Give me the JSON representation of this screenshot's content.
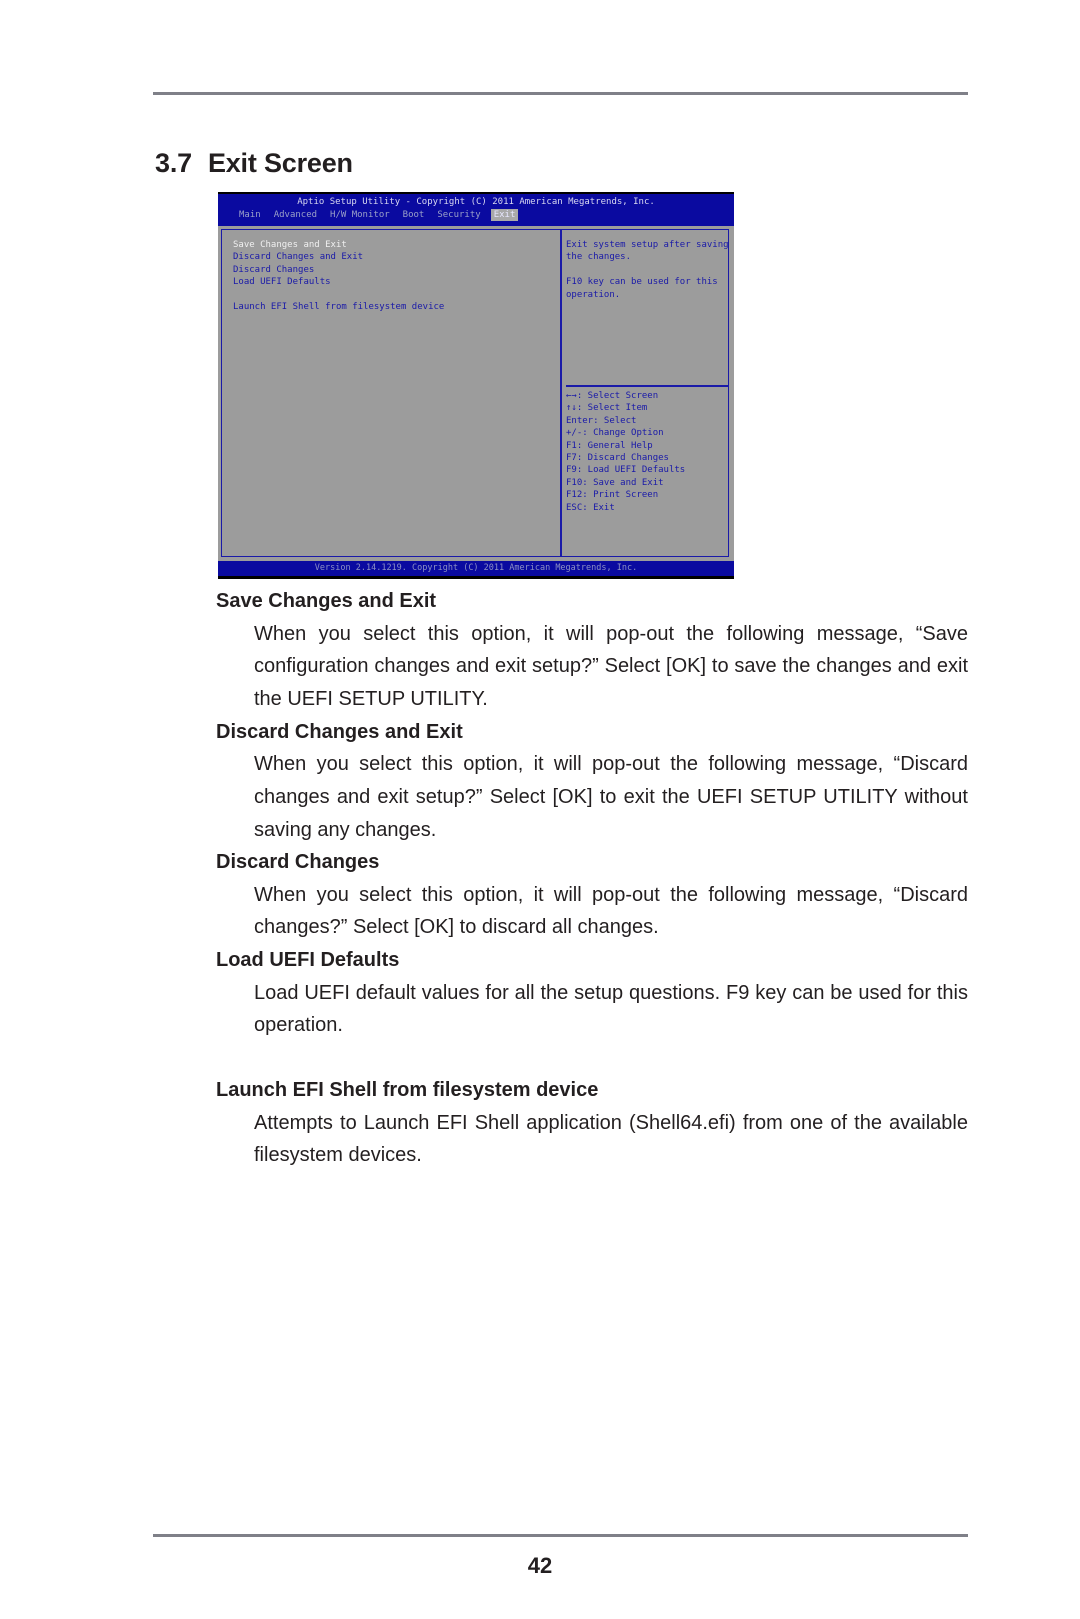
{
  "section": {
    "number": "3.7",
    "title": "Exit Screen"
  },
  "bios": {
    "header_title": "Aptio Setup Utility - Copyright (C) 2011 American Megatrends, Inc.",
    "tabs": [
      {
        "label": "Main",
        "active": false
      },
      {
        "label": "Advanced",
        "active": false
      },
      {
        "label": "H/W Monitor",
        "active": false
      },
      {
        "label": "Boot",
        "active": false
      },
      {
        "label": "Security",
        "active": false
      },
      {
        "label": "Exit",
        "active": true
      }
    ],
    "menu_items": [
      {
        "label": "Save Changes and Exit",
        "selected": true
      },
      {
        "label": "Discard Changes and Exit",
        "selected": false
      },
      {
        "label": "Discard Changes",
        "selected": false
      },
      {
        "label": "Load UEFI Defaults",
        "selected": false
      },
      {
        "label": "Launch EFI Shell from filesystem device",
        "selected": false
      }
    ],
    "help_text": [
      "Exit system setup after saving the changes.",
      "F10 key can be used for this operation."
    ],
    "key_legend": [
      "←→: Select Screen",
      "↑↓: Select Item",
      "Enter: Select",
      "+/-: Change Option",
      "F1: General Help",
      "F7: Discard Changes",
      "F9: Load UEFI Defaults",
      "F10: Save and Exit",
      "F12: Print Screen",
      "ESC: Exit"
    ],
    "footer": "Version 2.14.1219. Copyright (C) 2011 American Megatrends, Inc.",
    "colors": {
      "bar_blue": "#0a0aa0",
      "panel_gray": "#9c9c9c",
      "text_blue": "#1a1aa8",
      "selected_white": "#f0f0f0"
    }
  },
  "descriptions": [
    {
      "heading": "Save Changes and Exit",
      "text": "When you select this option, it will pop-out the following message, “Save configuration changes and exit setup?” Select [OK] to save the changes and exit the UEFI SETUP UTILITY."
    },
    {
      "heading": "Discard Changes and Exit",
      "text": "When you select this option, it will pop-out the following message, “Discard changes and exit setup?” Select [OK] to exit the UEFI SETUP UTILITY without saving any changes."
    },
    {
      "heading": "Discard Changes",
      "text": "When you select this option, it will pop-out the following message, “Discard changes?” Select [OK] to discard all changes."
    },
    {
      "heading": "Load UEFI Defaults",
      "text": "Load UEFI default values for all the setup questions. F9 key can be used for this operation."
    },
    {
      "heading": "Launch EFI Shell from filesystem device",
      "text": "Attempts to Launch EFI Shell application (Shell64.efi) from one of the available filesystem devices."
    }
  ],
  "page_number": "42"
}
